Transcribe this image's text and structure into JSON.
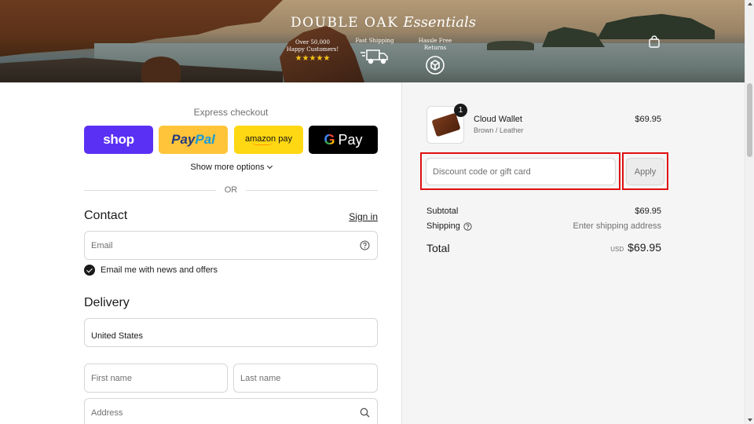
{
  "banner": {
    "brand_main": "DOUBLE OAK",
    "brand_script": "Essentials",
    "badge_customers_line1": "Over 50,000",
    "badge_customers_line2": "Happy Customers!",
    "badge_customers_stars": "★★★★★",
    "badge_shipping": "Fast Shipping",
    "badge_returns": "Hassle Free Returns",
    "cart_icon": "shopping-bag-icon"
  },
  "express": {
    "title": "Express checkout",
    "shop_label": "shop",
    "paypal_part1": "Pay",
    "paypal_part2": "Pal",
    "amazon_label": "amazon pay",
    "gpay_g": "G",
    "gpay_label": "Pay",
    "show_more": "Show more options",
    "or_text": "OR"
  },
  "contact": {
    "title": "Contact",
    "sign_in": "Sign in",
    "email_placeholder": "Email",
    "newsletter_label": "Email me with news and offers",
    "newsletter_checked": true
  },
  "delivery": {
    "title": "Delivery",
    "country_value": "United States",
    "first_name_placeholder": "First name",
    "last_name_placeholder": "Last name",
    "address_placeholder": "Address"
  },
  "order": {
    "item_name": "Cloud Wallet",
    "item_variant": "Brown / Leather",
    "item_price": "$69.95",
    "item_qty": "1",
    "discount_placeholder": "Discount code or gift card",
    "apply_label": "Apply",
    "subtotal_label": "Subtotal",
    "subtotal_value": "$69.95",
    "shipping_label": "Shipping",
    "shipping_value": "Enter shipping address",
    "total_label": "Total",
    "total_currency": "USD",
    "total_value": "$69.95"
  },
  "colors": {
    "shop_purple": "#5a31f4",
    "paypal_yellow": "#ffc439",
    "amazon_yellow": "#ffd814",
    "highlight_red": "#e01010"
  }
}
